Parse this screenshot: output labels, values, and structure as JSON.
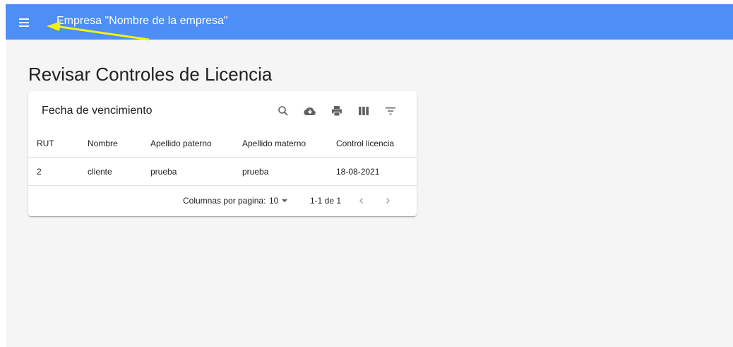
{
  "appbar": {
    "title": "Empresa \"Nombre de la empresa\"",
    "menu_icon": "menu-icon",
    "color": "#4d8ef7"
  },
  "annotation": {
    "arrow_color": "#f2f20d"
  },
  "page": {
    "title": "Revisar Controles de Licencia"
  },
  "table": {
    "toolbar_title": "Fecha de vencimiento",
    "toolbar_icons": [
      "search-icon",
      "cloud-download-icon",
      "print-icon",
      "view-columns-icon",
      "filter-icon"
    ],
    "columns": [
      "RUT",
      "Nombre",
      "Apellido paterno",
      "Apellido materno",
      "Control licencia"
    ],
    "rows": [
      [
        "2",
        "cliente",
        "prueba",
        "prueba",
        "18-08-2021"
      ]
    ],
    "footer": {
      "rows_per_page_label": "Columnas por pagina:",
      "rows_per_page_value": "10",
      "range": "1-1 de 1"
    }
  }
}
